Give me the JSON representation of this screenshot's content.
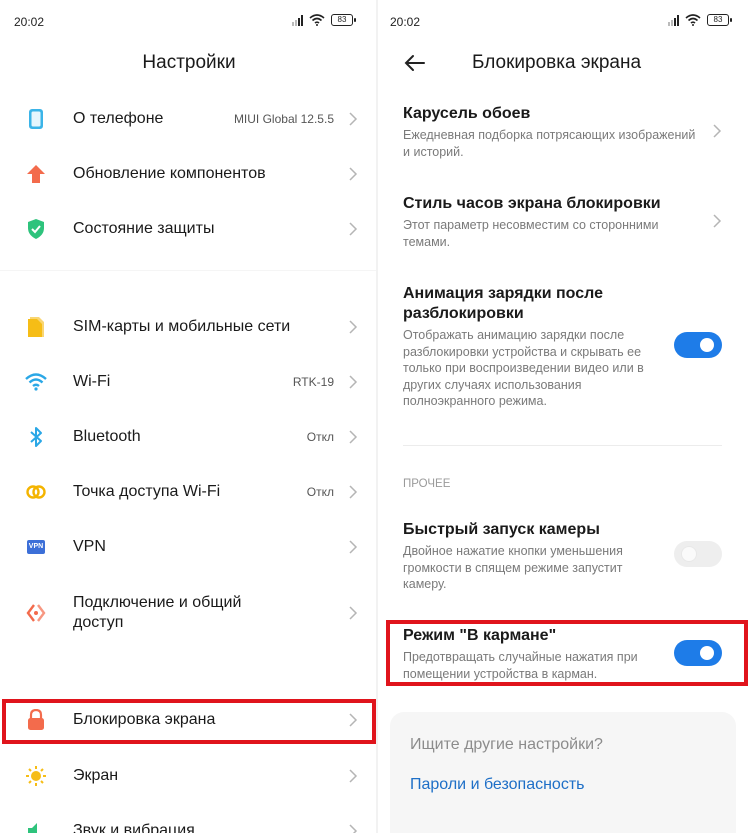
{
  "left": {
    "status": {
      "time": "20:02",
      "battery": "83"
    },
    "title": "Настройки",
    "rows": [
      {
        "label": "О телефоне",
        "value": "MIUI Global 12.5.5"
      },
      {
        "label": "Обновление компонентов",
        "value": ""
      },
      {
        "label": "Состояние защиты",
        "value": ""
      },
      {
        "label": "SIM-карты и мобильные сети",
        "value": ""
      },
      {
        "label": "Wi-Fi",
        "value": "RTK-19"
      },
      {
        "label": "Bluetooth",
        "value": "Откл"
      },
      {
        "label": "Точка доступа Wi-Fi",
        "value": "Откл"
      },
      {
        "label": "VPN",
        "value": ""
      },
      {
        "label": "Подключение и общий доступ",
        "value": ""
      },
      {
        "label": "Блокировка экрана",
        "value": ""
      },
      {
        "label": "Экран",
        "value": ""
      },
      {
        "label": "Звук и вибрация",
        "value": ""
      }
    ],
    "vpn_icon_text": "VPN"
  },
  "right": {
    "status": {
      "time": "20:02",
      "battery": "83"
    },
    "title": "Блокировка экрана",
    "options": [
      {
        "title": "Карусель обоев",
        "desc": "Ежедневная подборка потрясающих изображений и историй."
      },
      {
        "title": "Стиль часов экрана блокировки",
        "desc": "Этот параметр несовместим со сторонними темами."
      },
      {
        "title": "Анимация зарядки после разблокировки",
        "desc": "Отображать анимацию зарядки после разблокировки устройства и скрывать ее только при воспроизведении видео или в других случаях использования полноэкранного режима.",
        "on": true
      },
      {
        "title": "Быстрый запуск камеры",
        "desc": "Двойное нажатие кнопки уменьшения громкости в спящем режиме запустит камеру.",
        "on": false
      },
      {
        "title": "Режим \"В кармане\"",
        "desc": "Предотвращать случайные нажатия при помещении устройства в карман.",
        "on": true
      }
    ],
    "section_other": "ПРОЧЕЕ",
    "search_placeholder": "Ищите другие настройки?",
    "search_suggestion": "Пароли и безопасность"
  },
  "colors": {
    "accent": "#1e7ce8",
    "highlight": "#e0141c",
    "link": "#1e6fc7"
  }
}
